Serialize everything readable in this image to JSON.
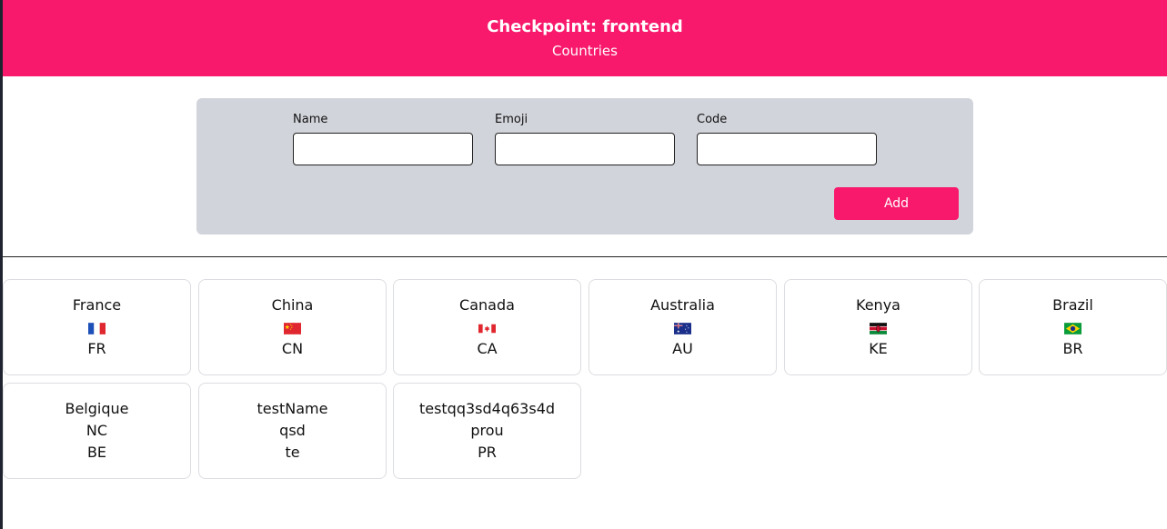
{
  "header": {
    "title": "Checkpoint: frontend",
    "subtitle": "Countries"
  },
  "form": {
    "name_label": "Name",
    "emoji_label": "Emoji",
    "code_label": "Code",
    "name_value": "",
    "emoji_value": "",
    "code_value": "",
    "add_label": "Add"
  },
  "countries": [
    {
      "name": "France",
      "emoji": "🇫🇷",
      "flag_icon": "flag-fr-icon",
      "code": "FR"
    },
    {
      "name": "China",
      "emoji": "🇨🇳",
      "flag_icon": "flag-cn-icon",
      "code": "CN"
    },
    {
      "name": "Canada",
      "emoji": "🇨🇦",
      "flag_icon": "flag-ca-icon",
      "code": "CA"
    },
    {
      "name": "Australia",
      "emoji": "🇦🇺",
      "flag_icon": "flag-au-icon",
      "code": "AU"
    },
    {
      "name": "Kenya",
      "emoji": "🇰🇪",
      "flag_icon": "flag-ke-icon",
      "code": "KE"
    },
    {
      "name": "Brazil",
      "emoji": "🇧🇷",
      "flag_icon": "flag-br-icon",
      "code": "BR"
    },
    {
      "name": "Belgique",
      "emoji": "NC",
      "code": "BE"
    },
    {
      "name": "testName",
      "emoji": "qsd",
      "code": "te"
    },
    {
      "name": "testqq3sd4q63s4d",
      "emoji": "prou",
      "code": "PR"
    }
  ],
  "colors": {
    "accent": "#f8186c",
    "panel": "#d2d4db",
    "card_border": "#dcdde2"
  }
}
